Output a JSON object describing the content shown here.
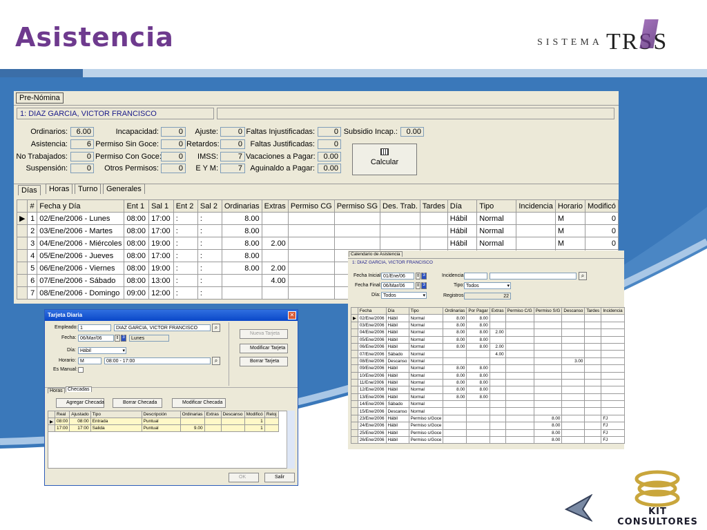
{
  "slide": {
    "title": "Asistencia",
    "logo_left": "SISTEMA",
    "logo_right": "TRSS",
    "footer_logo": "KIT CONSULTORES"
  },
  "prenomina": {
    "tab": "Pre-Nómina",
    "employee": "1: DIAZ GARCIA, VICTOR FRANCISCO",
    "fields": [
      {
        "label": "Ordinarios:",
        "value": "6.00"
      },
      {
        "label": "Asistencia:",
        "value": "6"
      },
      {
        "label": "No Trabajados:",
        "value": "0"
      },
      {
        "label": "Suspensión:",
        "value": "0"
      },
      {
        "label": "Incapacidad:",
        "value": "0"
      },
      {
        "label": "Permiso Sin Goce:",
        "value": "0"
      },
      {
        "label": "Permiso Con Goce:",
        "value": "0"
      },
      {
        "label": "Otros Permisos:",
        "value": "0"
      },
      {
        "label": "Ajuste:",
        "value": "0"
      },
      {
        "label": "Retardos:",
        "value": "0"
      },
      {
        "label": "IMSS:",
        "value": "7"
      },
      {
        "label": "E Y M:",
        "value": "7"
      },
      {
        "label": "Faltas Injustificadas:",
        "value": "0"
      },
      {
        "label": "Faltas Justificadas:",
        "value": "0"
      },
      {
        "label": "Vacaciones a Pagar:",
        "value": "0.00"
      },
      {
        "label": "Aguinaldo a Pagar:",
        "value": "0.00"
      },
      {
        "label": "Subsidio Incap.:",
        "value": "0.00"
      }
    ],
    "calc_button": "Calcular",
    "subtabs": [
      "Días",
      "Horas",
      "Turno",
      "Generales"
    ],
    "columns": [
      "#",
      "Fecha y Día",
      "Ent 1",
      "Sal 1",
      "Ent 2",
      "Sal 2",
      "Ordinarias",
      "Extras",
      "Permiso CG",
      "Permiso SG",
      "Des. Trab.",
      "Tardes",
      "Día",
      "Tipo",
      "Incidencia",
      "Horario",
      "Modificó"
    ],
    "rows": [
      [
        "1",
        "02/Ene/2006 - Lunes",
        "08:00",
        "17:00",
        ":",
        ":",
        "8.00",
        "",
        "",
        "",
        "",
        "",
        "Hábil",
        "Normal",
        "",
        "M",
        "0"
      ],
      [
        "2",
        "03/Ene/2006 - Martes",
        "08:00",
        "17:00",
        ":",
        ":",
        "8.00",
        "",
        "",
        "",
        "",
        "",
        "Hábil",
        "Normal",
        "",
        "M",
        "0"
      ],
      [
        "3",
        "04/Ene/2006 - Miércoles",
        "08:00",
        "19:00",
        ":",
        ":",
        "8.00",
        "2.00",
        "",
        "",
        "",
        "",
        "Hábil",
        "Normal",
        "",
        "M",
        "0"
      ],
      [
        "4",
        "05/Ene/2006 - Jueves",
        "08:00",
        "17:00",
        ":",
        ":",
        "8.00",
        "",
        "",
        "",
        "",
        "",
        "",
        "",
        "",
        "",
        ""
      ],
      [
        "5",
        "06/Ene/2006 - Viernes",
        "08:00",
        "19:00",
        ":",
        ":",
        "8.00",
        "2.00",
        "",
        "",
        "",
        "",
        "",
        "",
        "",
        "",
        ""
      ],
      [
        "6",
        "07/Ene/2006 - Sábado",
        "08:00",
        "13:00",
        ":",
        ":",
        "",
        "4.00",
        "",
        "",
        "",
        "",
        "",
        "",
        "",
        "",
        ""
      ],
      [
        "7",
        "08/Ene/2006 - Domingo",
        "09:00",
        "12:00",
        ":",
        ":",
        "",
        "",
        "",
        "",
        "",
        "",
        "",
        "",
        "",
        "",
        ""
      ]
    ]
  },
  "tarjeta": {
    "title": "Tarjeta Diaria",
    "close": "✕",
    "empleado_label": "Empleado:",
    "empleado_id": "1",
    "empleado_name": "DIAZ GARCIA, VICTOR FRANCISCO",
    "fecha_label": "Fecha:",
    "fecha": "06/Mar/06",
    "dia_semana": "Lunes",
    "dia_label": "Día:",
    "dia": "Hábil",
    "horario_label": "Horario:",
    "horario_code": "M",
    "horario": "08:00 - 17:00",
    "manual_label": "Es Manual:",
    "nueva": "Nueva Tarjeta",
    "modificar": "Modificar Tarjeta",
    "borrar": "Borrar Tarjeta",
    "tabs": [
      "Horas",
      "Checadas"
    ],
    "agregar": "Agregar Checada",
    "borrar_checada": "Borrar Checada",
    "modificar_checada": "Modificar Checada",
    "columns": [
      "Real",
      "Ajustado",
      "Tipo",
      "Descripción",
      "Ordinarias",
      "Extras",
      "Descanso",
      "Modificó",
      "Reloj"
    ],
    "rows": [
      [
        "08:00",
        "08:00",
        "Entrada",
        "Puntual",
        "",
        "",
        "",
        "1",
        ""
      ],
      [
        "17:00",
        "17:00",
        "Salida",
        "Puntual",
        "9.00",
        "",
        "",
        "1",
        ""
      ]
    ],
    "ok": "OK",
    "salir": "Salir"
  },
  "calendario": {
    "tab": "Calendario de Asistencia",
    "employee": "1: DIAZ GARCIA, VICTOR FRANCISCO",
    "fecha_inicial_label": "Fecha Inicial:",
    "fecha_inicial": "01/Ene/06",
    "fecha_final_label": "Fecha Final:",
    "fecha_final": "06/Mar/06",
    "dia_label": "Día:",
    "dia": "Todos",
    "incidencia_label": "Incidencia:",
    "tipo_label": "Tipo:",
    "tipo": "Todos",
    "registros_label": "Registros:",
    "registros": "22",
    "columns": [
      "Fecha",
      "Día",
      "Tipo",
      "Ordinarias",
      "Por Pagar",
      "Extras",
      "Permiso C/G",
      "Permiso S/G",
      "Descanso",
      "Tardes",
      "Incidencia"
    ],
    "rows": [
      [
        "02/Ene/2006",
        "Hábil",
        "Normal",
        "8.00",
        "8.00",
        "",
        "",
        "",
        "",
        "",
        ""
      ],
      [
        "03/Ene/2006",
        "Hábil",
        "Normal",
        "8.00",
        "8.00",
        "",
        "",
        "",
        "",
        "",
        ""
      ],
      [
        "04/Ene/2006",
        "Hábil",
        "Normal",
        "8.00",
        "8.00",
        "2.00",
        "",
        "",
        "",
        "",
        ""
      ],
      [
        "05/Ene/2006",
        "Hábil",
        "Normal",
        "8.00",
        "8.00",
        "",
        "",
        "",
        "",
        "",
        ""
      ],
      [
        "06/Ene/2006",
        "Hábil",
        "Normal",
        "8.00",
        "8.00",
        "2.00",
        "",
        "",
        "",
        "",
        ""
      ],
      [
        "07/Ene/2006",
        "Sábado",
        "Normal",
        "",
        "",
        "4.00",
        "",
        "",
        "",
        "",
        ""
      ],
      [
        "08/Ene/2006",
        "Descanso",
        "Normal",
        "",
        "",
        "",
        "",
        "",
        "3.00",
        "",
        ""
      ],
      [
        "09/Ene/2006",
        "Hábil",
        "Normal",
        "8.00",
        "8.00",
        "",
        "",
        "",
        "",
        "",
        ""
      ],
      [
        "10/Ene/2006",
        "Hábil",
        "Normal",
        "8.00",
        "8.00",
        "",
        "",
        "",
        "",
        "",
        ""
      ],
      [
        "11/Ene/2006",
        "Hábil",
        "Normal",
        "8.00",
        "8.00",
        "",
        "",
        "",
        "",
        "",
        ""
      ],
      [
        "12/Ene/2006",
        "Hábil",
        "Normal",
        "8.00",
        "8.00",
        "",
        "",
        "",
        "",
        "",
        ""
      ],
      [
        "13/Ene/2006",
        "Hábil",
        "Normal",
        "8.00",
        "8.00",
        "",
        "",
        "",
        "",
        "",
        ""
      ],
      [
        "14/Ene/2006",
        "Sábado",
        "Normal",
        "",
        "",
        "",
        "",
        "",
        "",
        "",
        ""
      ],
      [
        "15/Ene/2006",
        "Descanso",
        "Normal",
        "",
        "",
        "",
        "",
        "",
        "",
        "",
        ""
      ],
      [
        "23/Ene/2006",
        "Hábil",
        "Permiso s/Goce",
        "",
        "",
        "",
        "",
        "8.00",
        "",
        "",
        "FJ"
      ],
      [
        "24/Ene/2006",
        "Hábil",
        "Permiso s/Goce",
        "",
        "",
        "",
        "",
        "8.00",
        "",
        "",
        "FJ"
      ],
      [
        "25/Ene/2006",
        "Hábil",
        "Permiso s/Goce",
        "",
        "",
        "",
        "",
        "8.00",
        "",
        "",
        "FJ"
      ],
      [
        "26/Ene/2006",
        "Hábil",
        "Permiso s/Goce",
        "",
        "",
        "",
        "",
        "8.00",
        "",
        "",
        "FJ"
      ]
    ]
  }
}
